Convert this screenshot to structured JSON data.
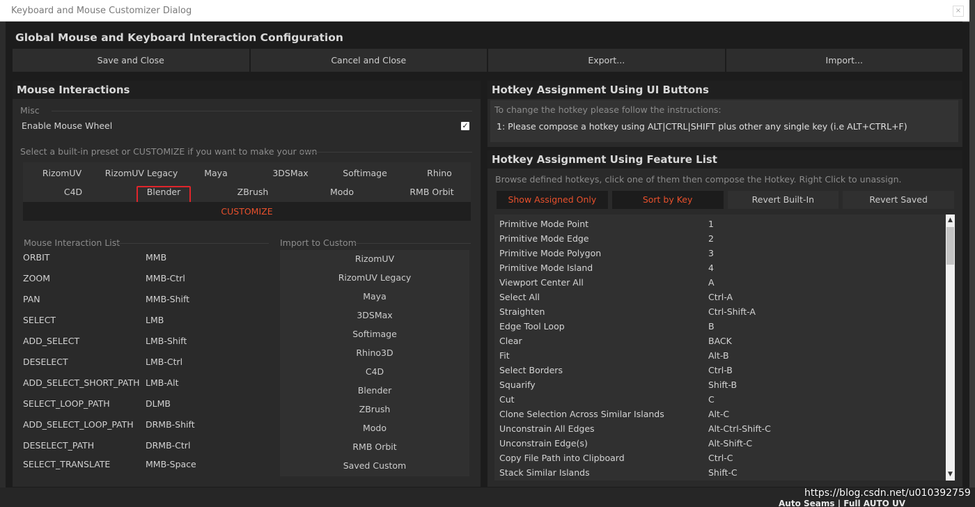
{
  "window": {
    "title": "Keyboard and Mouse Customizer Dialog",
    "close_glyph": "×"
  },
  "dialog": {
    "heading": "Global Mouse and Keyboard Interaction Configuration",
    "buttons": [
      "Save and Close",
      "Cancel and Close",
      "Export...",
      "Import..."
    ]
  },
  "mouse": {
    "heading": "Mouse Interactions",
    "misc_label": "Misc",
    "wheel_label": "Enable Mouse Wheel",
    "wheel_checked": true,
    "checkmark": "✓",
    "preset_label": "Select a built-in preset or CUSTOMIZE if you want to make your own",
    "presets_row1": [
      "RizomUV",
      "RizomUV Legacy",
      "Maya",
      "3DSMax",
      "Softimage",
      "Rhino"
    ],
    "presets_row2": [
      "C4D",
      "Blender",
      "ZBrush",
      "Modo",
      "RMB Orbit"
    ],
    "selected_preset": "Blender",
    "customize_label": "CUSTOMIZE",
    "list_label": "Mouse Interaction List",
    "import_label": "Import to Custom",
    "interactions": [
      {
        "name": "ORBIT",
        "key": "MMB"
      },
      {
        "name": "ZOOM",
        "key": "MMB-Ctrl"
      },
      {
        "name": "PAN",
        "key": "MMB-Shift"
      },
      {
        "name": "SELECT",
        "key": "LMB"
      },
      {
        "name": "ADD_SELECT",
        "key": "LMB-Shift"
      },
      {
        "name": "DESELECT",
        "key": "LMB-Ctrl"
      },
      {
        "name": "ADD_SELECT_SHORT_PATH",
        "key": "LMB-Alt"
      },
      {
        "name": "SELECT_LOOP_PATH",
        "key": "DLMB"
      },
      {
        "name": "ADD_SELECT_LOOP_PATH",
        "key": "DRMB-Shift"
      },
      {
        "name": "DESELECT_PATH",
        "key": "DRMB-Ctrl"
      },
      {
        "name": "SELECT_TRANSLATE",
        "key": "MMB-Space"
      }
    ],
    "import_items": [
      "RizomUV",
      "RizomUV Legacy",
      "Maya",
      "3DSMax",
      "Softimage",
      "Rhino3D",
      "C4D",
      "Blender",
      "ZBrush",
      "Modo",
      "RMB Orbit",
      "Saved Custom"
    ]
  },
  "hotkey_ui": {
    "heading": "Hotkey Assignment Using UI Buttons",
    "instruction_intro": "To change the hotkey please follow the instructions:",
    "instruction_step": "1: Please compose a hotkey using ALT|CTRL|SHIFT plus other any single key (i.e ALT+CTRL+F)"
  },
  "hotkey_list": {
    "heading": "Hotkey Assignment Using Feature List",
    "description": "Browse defined hotkeys, click one of them then compose the Hotkey. Right Click to unassign.",
    "filters": [
      {
        "label": "Show Assigned Only",
        "active": true
      },
      {
        "label": "Sort by Key",
        "active": true
      },
      {
        "label": "Revert Built-In",
        "active": false
      },
      {
        "label": "Revert Saved",
        "active": false
      }
    ],
    "scroll_up": "▲",
    "scroll_down": "▼",
    "entries": [
      {
        "name": "Primitive Mode Point",
        "key": "1"
      },
      {
        "name": "Primitive Mode Edge",
        "key": "2"
      },
      {
        "name": "Primitive Mode Polygon",
        "key": "3"
      },
      {
        "name": "Primitive Mode Island",
        "key": "4"
      },
      {
        "name": "Viewport Center All",
        "key": "A"
      },
      {
        "name": "Select All",
        "key": "Ctrl-A"
      },
      {
        "name": "Straighten",
        "key": "Ctrl-Shift-A"
      },
      {
        "name": "Edge Tool Loop",
        "key": "B"
      },
      {
        "name": "Clear",
        "key": "BACK"
      },
      {
        "name": "Fit",
        "key": "Alt-B"
      },
      {
        "name": "Select Borders",
        "key": "Ctrl-B"
      },
      {
        "name": "Squarify",
        "key": "Shift-B"
      },
      {
        "name": "Cut",
        "key": "C"
      },
      {
        "name": "Clone Selection Across Similar Islands",
        "key": "Alt-C"
      },
      {
        "name": "Unconstrain All Edges",
        "key": "Alt-Ctrl-Shift-C"
      },
      {
        "name": "Unconstrain Edge(s)",
        "key": "Alt-Shift-C"
      },
      {
        "name": "Copy File Path into Clipboard",
        "key": "Ctrl-C"
      },
      {
        "name": "Stack Similar Islands",
        "key": "Shift-C"
      }
    ]
  },
  "background": {
    "status_text": "Auto Seams | Full AUTO UV",
    "watermark": "https://blog.csdn.net/u010392759"
  }
}
